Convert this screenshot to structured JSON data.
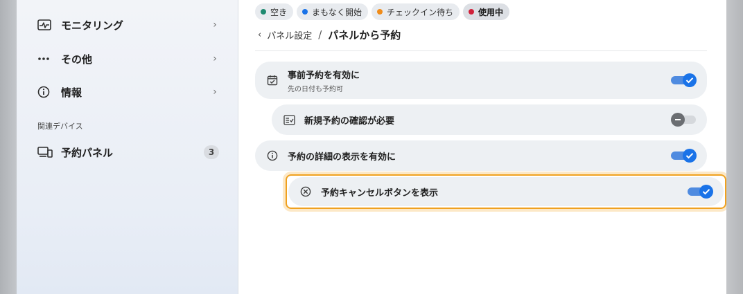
{
  "sidebar": {
    "items": [
      {
        "label": "モニタリング",
        "icon": "monitoring-icon"
      },
      {
        "label": "その他",
        "icon": "more-icon"
      },
      {
        "label": "情報",
        "icon": "info-icon"
      }
    ],
    "section_label": "関連デバイス",
    "device": {
      "label": "予約パネル",
      "count": "3",
      "icon": "panel-device-icon"
    }
  },
  "status_chips": [
    {
      "label": "空き",
      "color": "#1f8a70"
    },
    {
      "label": "まもなく開始",
      "color": "#1a73e8"
    },
    {
      "label": "チェックイン待ち",
      "color": "#f08c1a"
    },
    {
      "label": "使用中",
      "color": "#d0213a"
    }
  ],
  "breadcrumb": {
    "back_icon": "chevron-left-icon",
    "parent": "パネル設定",
    "separator": "/",
    "current": "パネルから予約"
  },
  "settings": [
    {
      "title": "事前予約を有効に",
      "subtitle": "先の日付も予約可",
      "icon": "calendar-check-icon",
      "enabled": true
    },
    {
      "title": "新規予約の確認が必要",
      "icon": "checklist-icon",
      "enabled": false
    },
    {
      "title": "予約の詳細の表示を有効に",
      "icon": "info-icon",
      "enabled": true
    },
    {
      "title": "予約キャンセルボタンを表示",
      "icon": "cancel-circle-icon",
      "enabled": true,
      "focused": true
    }
  ],
  "colors": {
    "accent": "#1a73e8",
    "focus_ring": "#f0a11f",
    "row_bg": "#edf0f3"
  }
}
